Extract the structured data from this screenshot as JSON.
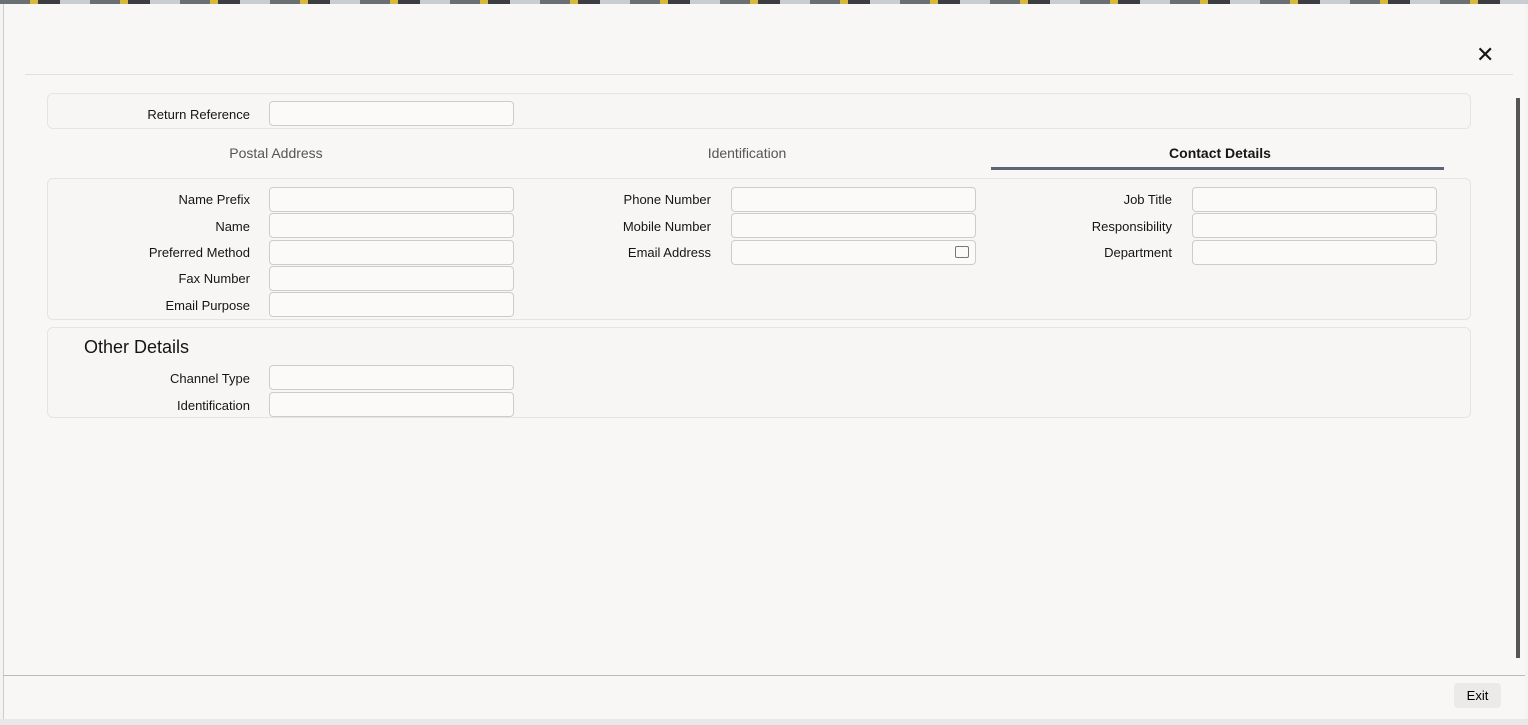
{
  "close_label": "✕",
  "return_reference": {
    "label": "Return Reference",
    "value": ""
  },
  "tabs": [
    {
      "label": "Postal Address"
    },
    {
      "label": "Identification"
    },
    {
      "label": "Contact Details"
    }
  ],
  "contact": {
    "col1": [
      {
        "label": "Name Prefix",
        "value": ""
      },
      {
        "label": "Name",
        "value": ""
      },
      {
        "label": "Preferred Method",
        "value": ""
      },
      {
        "label": "Fax Number",
        "value": ""
      },
      {
        "label": "Email Purpose",
        "value": ""
      }
    ],
    "col2": [
      {
        "label": "Phone Number",
        "value": ""
      },
      {
        "label": "Mobile Number",
        "value": ""
      },
      {
        "label": "Email Address",
        "value": ""
      }
    ],
    "col3": [
      {
        "label": "Job Title",
        "value": ""
      },
      {
        "label": "Responsibility",
        "value": ""
      },
      {
        "label": "Department",
        "value": ""
      }
    ]
  },
  "other": {
    "title": "Other Details",
    "fields": [
      {
        "label": "Channel Type",
        "value": ""
      },
      {
        "label": "Identification",
        "value": ""
      }
    ]
  },
  "exit_label": "Exit"
}
